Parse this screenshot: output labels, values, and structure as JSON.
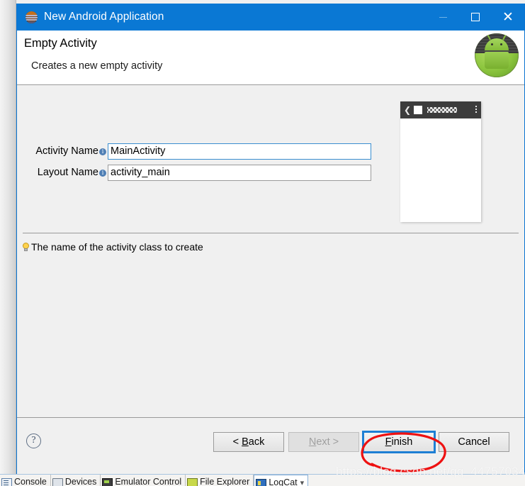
{
  "window": {
    "title": "New Android Application",
    "icon": "eclipse-wizard-icon",
    "controls": {
      "minimize": "minimize-icon",
      "maximize": "maximize-icon",
      "close": "close-icon"
    }
  },
  "header": {
    "title": "Empty Activity",
    "subtitle": "Creates a new empty activity",
    "badge_icon": "android-robot-icon"
  },
  "form": {
    "fields": [
      {
        "label": "Activity Name",
        "info_icon": "info-icon",
        "value": "MainActivity",
        "focused": true
      },
      {
        "label": "Layout Name",
        "info_icon": "info-icon",
        "value": "activity_main",
        "focused": false
      }
    ]
  },
  "preview": {
    "back_icon": "back-arrow-icon",
    "app_icon": "app-launcher-icon",
    "title_placeholder": "zigzag-title-placeholder",
    "overflow_icon": "overflow-menu-icon"
  },
  "hint": {
    "icon": "lightbulb-icon",
    "text": "The name of the activity class to create"
  },
  "footer": {
    "help_label": "?",
    "buttons": [
      {
        "name": "back",
        "prefix": "< ",
        "mnemonic": "B",
        "suffix": "ack",
        "disabled": false,
        "focused": false
      },
      {
        "name": "next",
        "prefix": "",
        "mnemonic": "N",
        "suffix": "ext >",
        "disabled": true,
        "focused": false
      },
      {
        "name": "finish",
        "prefix": "",
        "mnemonic": "F",
        "suffix": "inish",
        "disabled": false,
        "focused": true
      },
      {
        "name": "cancel",
        "prefix": "",
        "mnemonic": "",
        "suffix": "Cancel",
        "disabled": false,
        "focused": false
      }
    ]
  },
  "annotation": {
    "type": "red-hand-drawn-ellipse",
    "color": "#ee1111",
    "target": "finish-button"
  },
  "watermark": {
    "text": "https://blog.csdn.net/qq_44757034"
  },
  "ide_tabs": [
    {
      "label": "Console",
      "icon": "console-icon",
      "selected": false
    },
    {
      "label": "Devices",
      "icon": "devices-icon",
      "selected": false
    },
    {
      "label": "Emulator Control",
      "icon": "emulator-icon",
      "selected": false
    },
    {
      "label": "File Explorer",
      "icon": "explorer-icon",
      "selected": false
    },
    {
      "label": "LogCat",
      "icon": "logcat-icon",
      "selected": true
    }
  ],
  "colors": {
    "titlebar": "#0a78d4",
    "accent": "#1e7fd4",
    "dialog_bg": "#f0f0f0",
    "annotation": "#ee1111"
  }
}
